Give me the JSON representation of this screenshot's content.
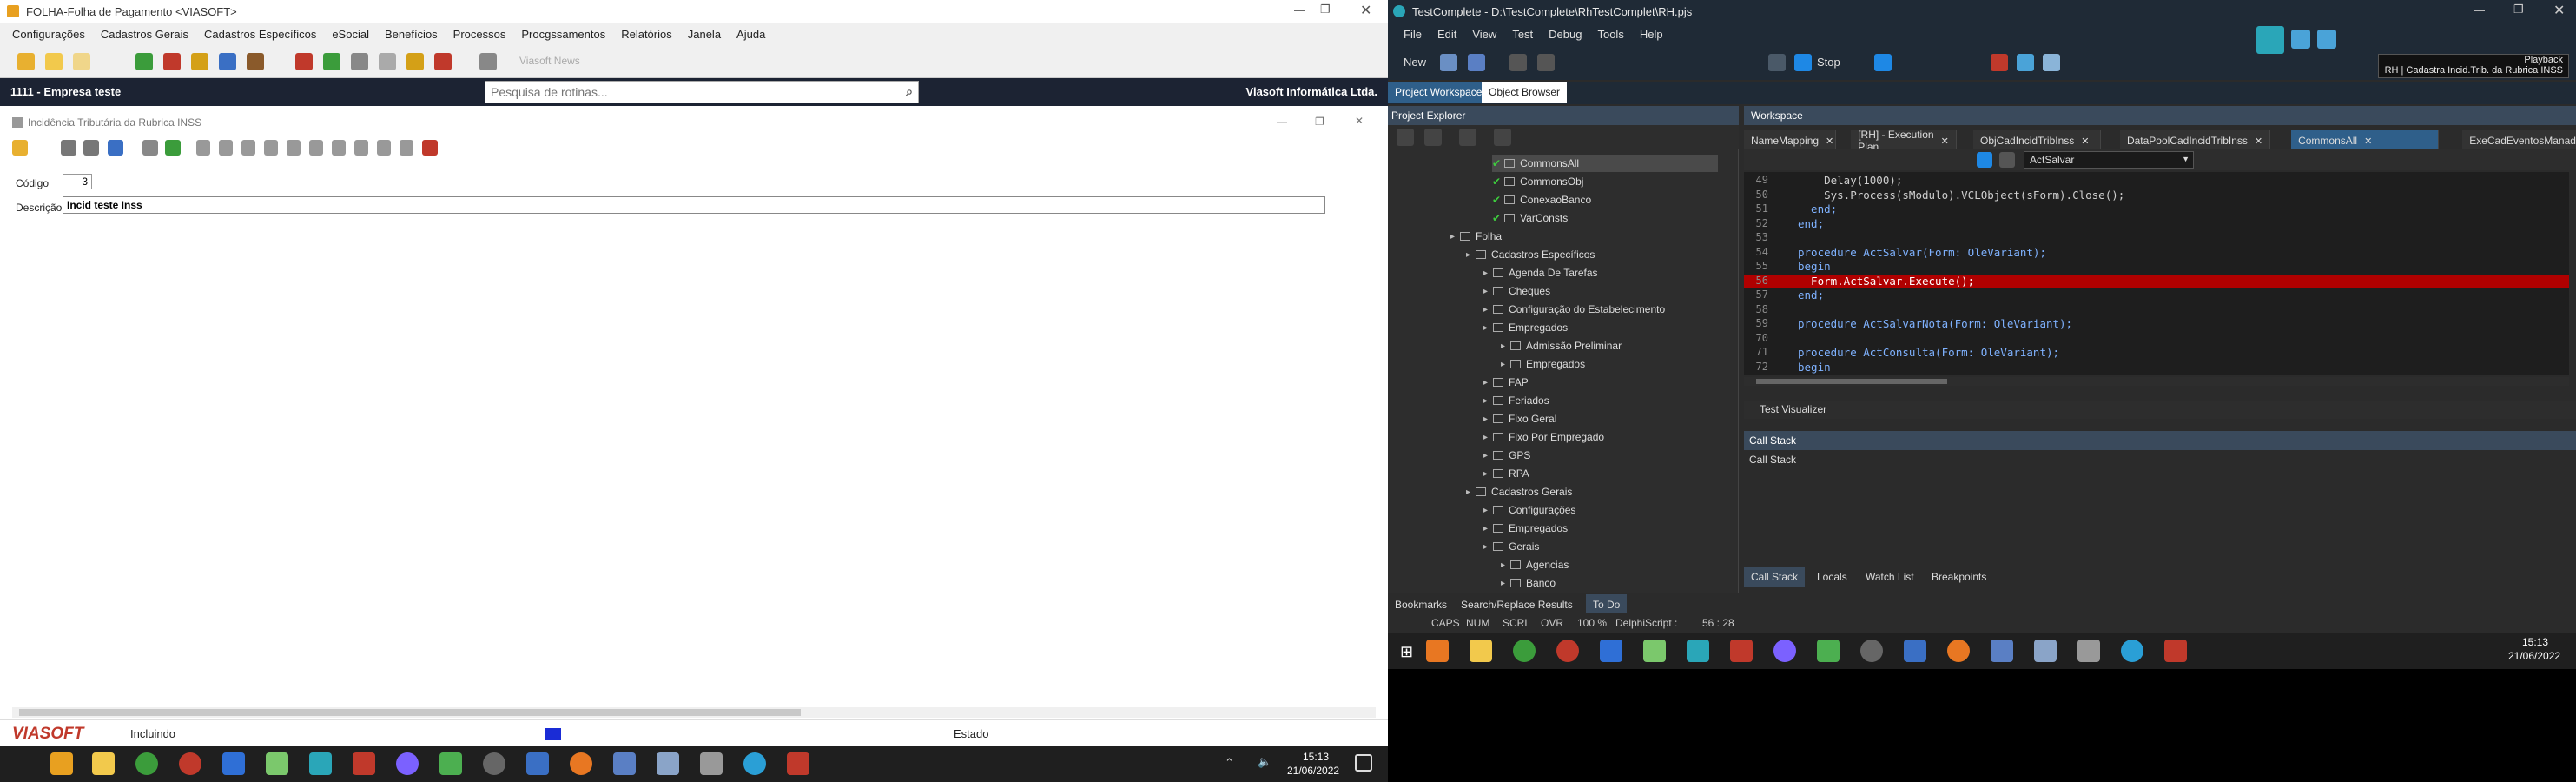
{
  "left_app": {
    "title": "FOLHA-Folha de Pagamento <VIASOFT>",
    "menu": [
      "Configurações",
      "Cadastros Gerais",
      "Cadastros Específicos",
      "eSocial",
      "Benefícios",
      "Processos",
      "Procgssamentos",
      "Relatórios",
      "Janela",
      "Ajuda"
    ],
    "news_label": "Viasoft News",
    "company": "1111 - Empresa teste",
    "search_placeholder": "Pesquisa de rotinas...",
    "vendor": "Viasoft Informática Ltda.",
    "subwindow_title": "Incidência Tributária da Rubrica INSS",
    "codigo_label": "Código",
    "codigo_value": "3",
    "descricao_label": "Descrição",
    "descricao_value": "Incid teste Inss",
    "brand": "VIASOFT",
    "status_mode": "Incluindo",
    "status_estado": "Estado",
    "clock_time": "15:13",
    "clock_date": "21/06/2022"
  },
  "right_app": {
    "title": "TestComplete - D:\\TestComplete\\RhTestComplet\\RH.pjs",
    "menu": [
      "File",
      "Edit",
      "View",
      "Test",
      "Debug",
      "Tools",
      "Help"
    ],
    "new_label": "New",
    "stop_label": "Stop",
    "playback_label": "Playback",
    "playback_target": "RH | Cadastra Incid.Trib. da Rubrica INSS",
    "panel_tabs": [
      "Project Workspace",
      "Object Browser"
    ],
    "project_explorer_title": "Project Explorer",
    "workspace_title": "Workspace",
    "editor_tabs": [
      "NameMapping",
      "[RH] - Execution Plan",
      "ObjCadIncidTribInss",
      "DataPoolCadIncidTribInss",
      "CommonsAll",
      "ExeCadEventosManad"
    ],
    "routine_dropdown": "ActSalvar",
    "tree": [
      {
        "label": "CommonsAll",
        "check": true
      },
      {
        "label": "CommonsObj",
        "check": true
      },
      {
        "label": "ConexaoBanco",
        "check": true
      },
      {
        "label": "VarConsts",
        "check": true
      },
      {
        "label": "Folha"
      },
      {
        "label": "Cadastros Específicos"
      },
      {
        "label": "Agenda De Tarefas"
      },
      {
        "label": "Cheques"
      },
      {
        "label": "Configuração do Estabelecimento"
      },
      {
        "label": "Empregados"
      },
      {
        "label": "Admissão Preliminar"
      },
      {
        "label": "Empregados"
      },
      {
        "label": "FAP"
      },
      {
        "label": "Feriados"
      },
      {
        "label": "Fixo Geral"
      },
      {
        "label": "Fixo Por Empregado"
      },
      {
        "label": "GPS"
      },
      {
        "label": "RPA"
      },
      {
        "label": "Cadastros Gerais"
      },
      {
        "label": "Configurações"
      },
      {
        "label": "Empregados"
      },
      {
        "label": "Gerais"
      },
      {
        "label": "Agencias"
      },
      {
        "label": "Banco"
      }
    ],
    "code_lines": [
      {
        "n": "49",
        "t": "    Delay(1000);"
      },
      {
        "n": "50",
        "t": "    Sys.Process(sModulo).VCLObject(sForm).Close();"
      },
      {
        "n": "51",
        "t": "  end;"
      },
      {
        "n": "52",
        "t": "end;"
      },
      {
        "n": "53",
        "t": ""
      },
      {
        "n": "54",
        "t": "procedure ActSalvar(Form: OleVariant);"
      },
      {
        "n": "55",
        "t": "begin"
      },
      {
        "n": "56",
        "t": "  Form.ActSalvar.Execute();"
      },
      {
        "n": "57",
        "t": "end;"
      },
      {
        "n": "58",
        "t": ""
      },
      {
        "n": "59",
        "t": "procedure ActSalvarNota(Form: OleVariant);"
      },
      {
        "n": "70",
        "t": ""
      },
      {
        "n": "71",
        "t": "procedure ActConsulta(Form: OleVariant);"
      },
      {
        "n": "72",
        "t": "begin"
      }
    ],
    "test_visualizer": "Test Visualizer",
    "call_stack_title": "Call Stack",
    "call_stack_header": "Call Stack",
    "bottom_tabs": [
      "Call Stack",
      "Locals",
      "Watch List",
      "Breakpoints"
    ],
    "left_bottom_tabs": [
      "Bookmarks",
      "Search/Replace Results",
      "To Do"
    ],
    "status_items": [
      "CAPS",
      "NUM",
      "SCRL",
      "OVR",
      "100 %",
      "DelphiScript :",
      "56 : 28"
    ],
    "clock_time": "15:13",
    "clock_date": "21/06/2022"
  },
  "colors": {
    "highlight_line": "#b00000",
    "active_tab": "#2f5f8a",
    "dark_nav": "#1c2333"
  }
}
